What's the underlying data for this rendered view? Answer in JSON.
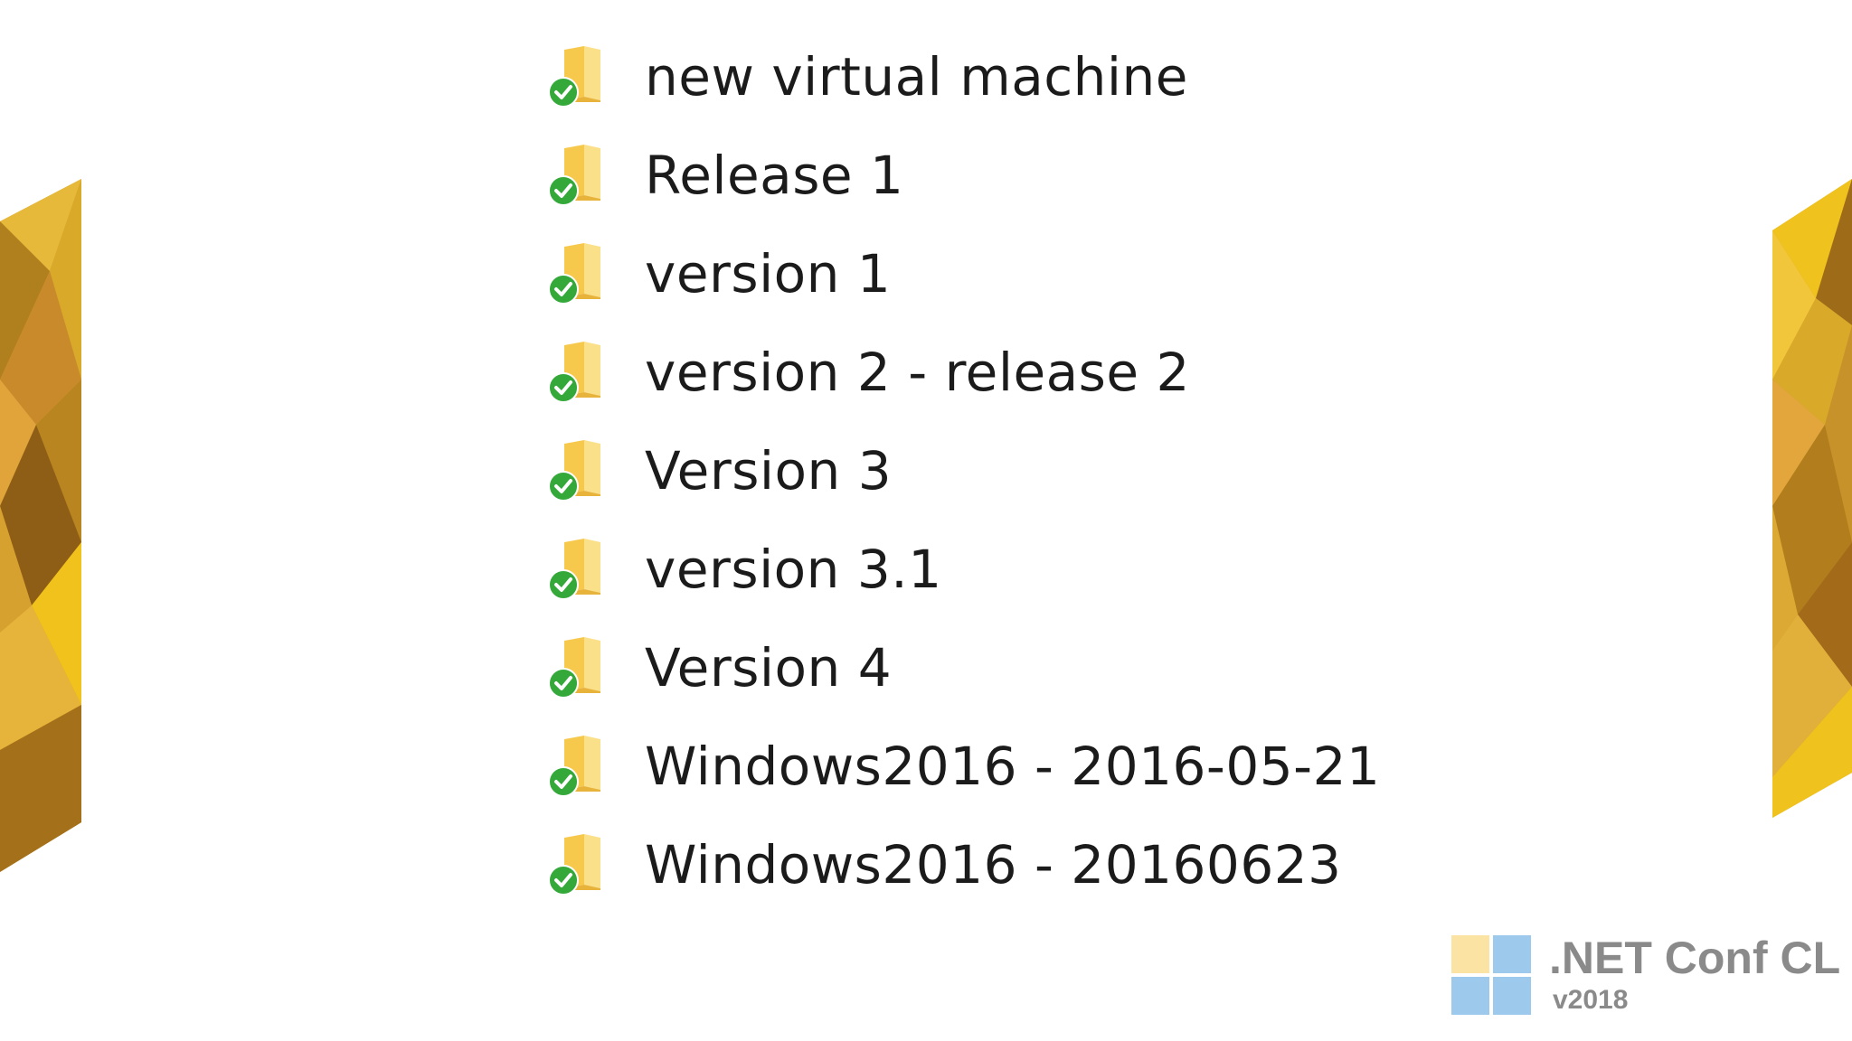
{
  "folders": [
    {
      "label": "new virtual machine",
      "icon": "folder-synced-icon"
    },
    {
      "label": "Release 1",
      "icon": "folder-synced-icon"
    },
    {
      "label": "version 1",
      "icon": "folder-synced-icon"
    },
    {
      "label": "version 2 - release 2",
      "icon": "folder-synced-icon"
    },
    {
      "label": "Version 3",
      "icon": "folder-synced-icon"
    },
    {
      "label": "version 3.1",
      "icon": "folder-synced-icon"
    },
    {
      "label": "Version 4",
      "icon": "folder-synced-icon"
    },
    {
      "label": "Windows2016 - 2016-05-21",
      "icon": "folder-synced-icon"
    },
    {
      "label": "Windows2016 - 20160623",
      "icon": "folder-synced-icon"
    }
  ],
  "brand": {
    "title": ".NET Conf CL",
    "version": "v2018",
    "logo_colors": [
      "#fbe3a3",
      "#9cc9ec",
      "#9cc9ec",
      "#9cc9ec"
    ]
  },
  "colors": {
    "folder": "#f6c94c",
    "check": "#34a93a",
    "decoration": "#d9a92a"
  }
}
